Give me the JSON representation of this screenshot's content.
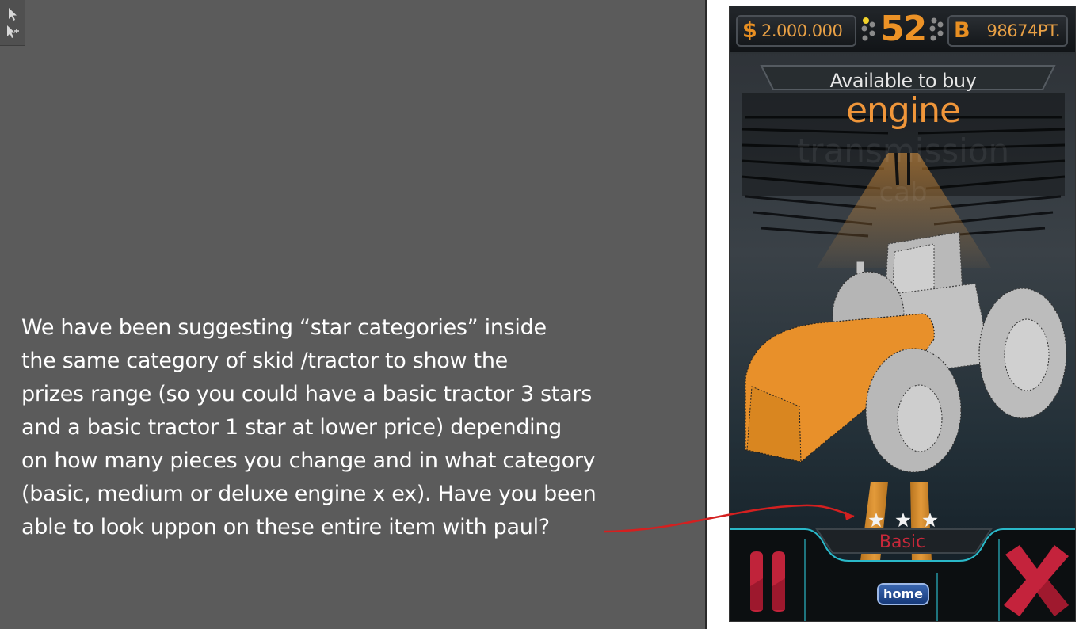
{
  "annotation": {
    "lines": [
      "We have been suggesting “star categories” inside",
      "the same category of skid /tractor to show the",
      "prizes range (so you could have a basic tractor 3 stars",
      "and a basic tractor 1 star at lower price) depending",
      "on how many pieces you change and in what category",
      "(basic, medium or deluxe engine x ex). Have you been",
      "able to look uppon on these entire item with paul?"
    ]
  },
  "toolbox": {
    "tools": [
      "selection-tool-icon",
      "direct-selection-tool-icon"
    ]
  },
  "hud": {
    "money_symbol": "$",
    "money": "2.000.000",
    "level": "52",
    "points_symbol": "B",
    "points": "98674PT."
  },
  "shop": {
    "available_label": "Available to buy",
    "category": "engine",
    "next_category": "transmission",
    "ghost_category_2": "cab",
    "rating": 3,
    "rating_max": 3,
    "tier_label": "Basic"
  },
  "buttons": {
    "home": "home",
    "pause_icon": "pause-icon",
    "close_icon": "close-icon"
  },
  "colors": {
    "accent_orange": "#e88f22",
    "tier_red": "#c8283a",
    "canvas_gray": "#5b5b5b",
    "arrow_red": "#d42020",
    "hud_frame_cyan": "#2ab8c8"
  }
}
